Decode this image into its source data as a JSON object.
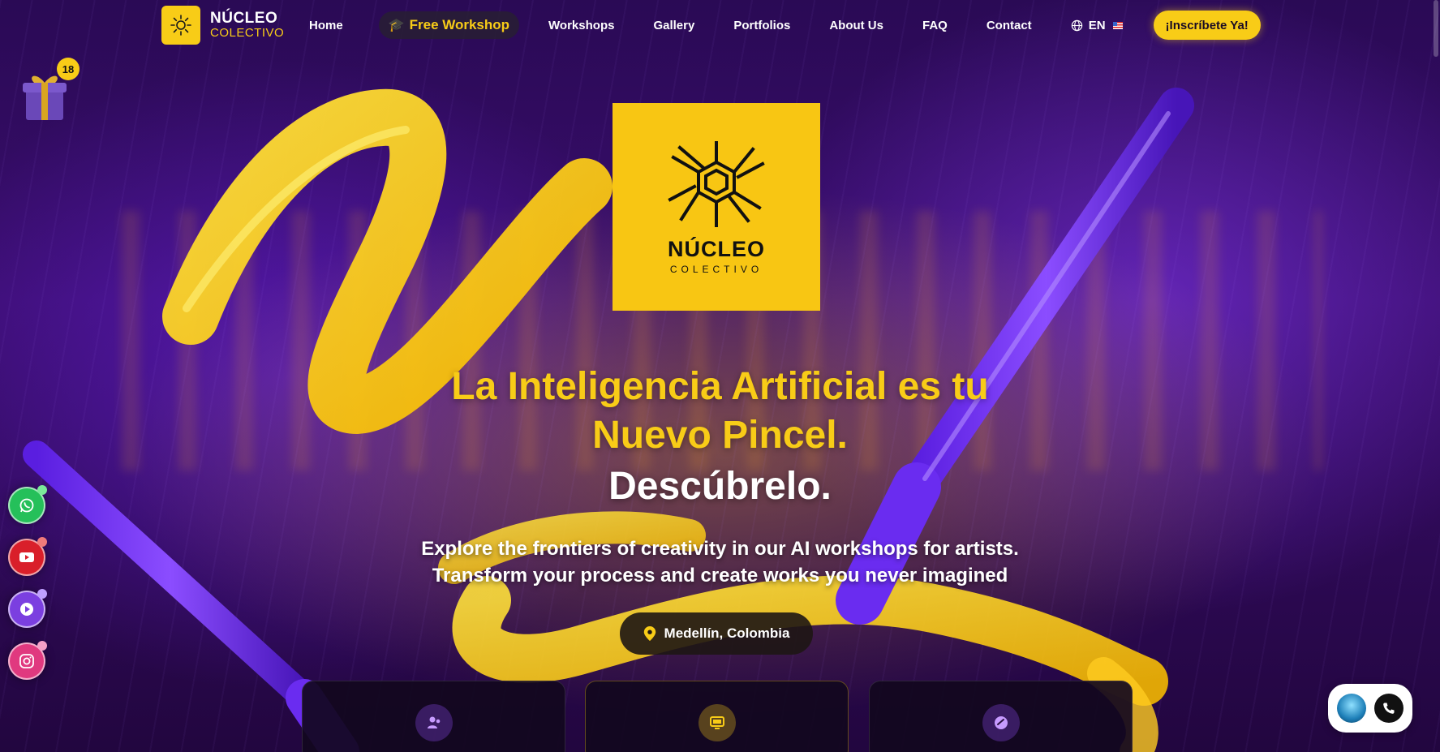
{
  "brand": {
    "title": "NÚCLEO",
    "subtitle": "COLECTIVO"
  },
  "nav": {
    "home": "Home",
    "free_workshop": "Free Workshop",
    "workshops": "Workshops",
    "gallery": "Gallery",
    "portfolios": "Portfolios",
    "about": "About Us",
    "faq": "FAQ",
    "contact": "Contact",
    "language": "EN",
    "cta": "¡Inscríbete Ya!"
  },
  "gift": {
    "count": "18"
  },
  "hero": {
    "logo_title": "NÚCLEO",
    "logo_subtitle": "COLECTIVO",
    "headline_line1": "La Inteligencia Artificial es tu",
    "headline_line2": "Nuevo Pincel.",
    "headline_accent": "Descúbrelo.",
    "subtitle_line1": "Explore the frontiers of creativity in our AI workshops for artists.",
    "subtitle_line2": "Transform your process and create works you never imagined",
    "location": "Medellín, Colombia"
  },
  "feature_cards": [
    {
      "icon": "users-icon"
    },
    {
      "icon": "monitor-icon"
    },
    {
      "icon": "palette-icon"
    }
  ],
  "social": [
    {
      "name": "whatsapp-icon"
    },
    {
      "name": "youtube-icon"
    },
    {
      "name": "play-icon"
    },
    {
      "name": "instagram-icon"
    }
  ],
  "colors": {
    "accent": "#f8cc17",
    "background": "#2a0a55",
    "whatsapp": "#25c05a",
    "youtube": "#e02424",
    "play": "#8a3ff0",
    "instagram": "#e43e8c"
  }
}
